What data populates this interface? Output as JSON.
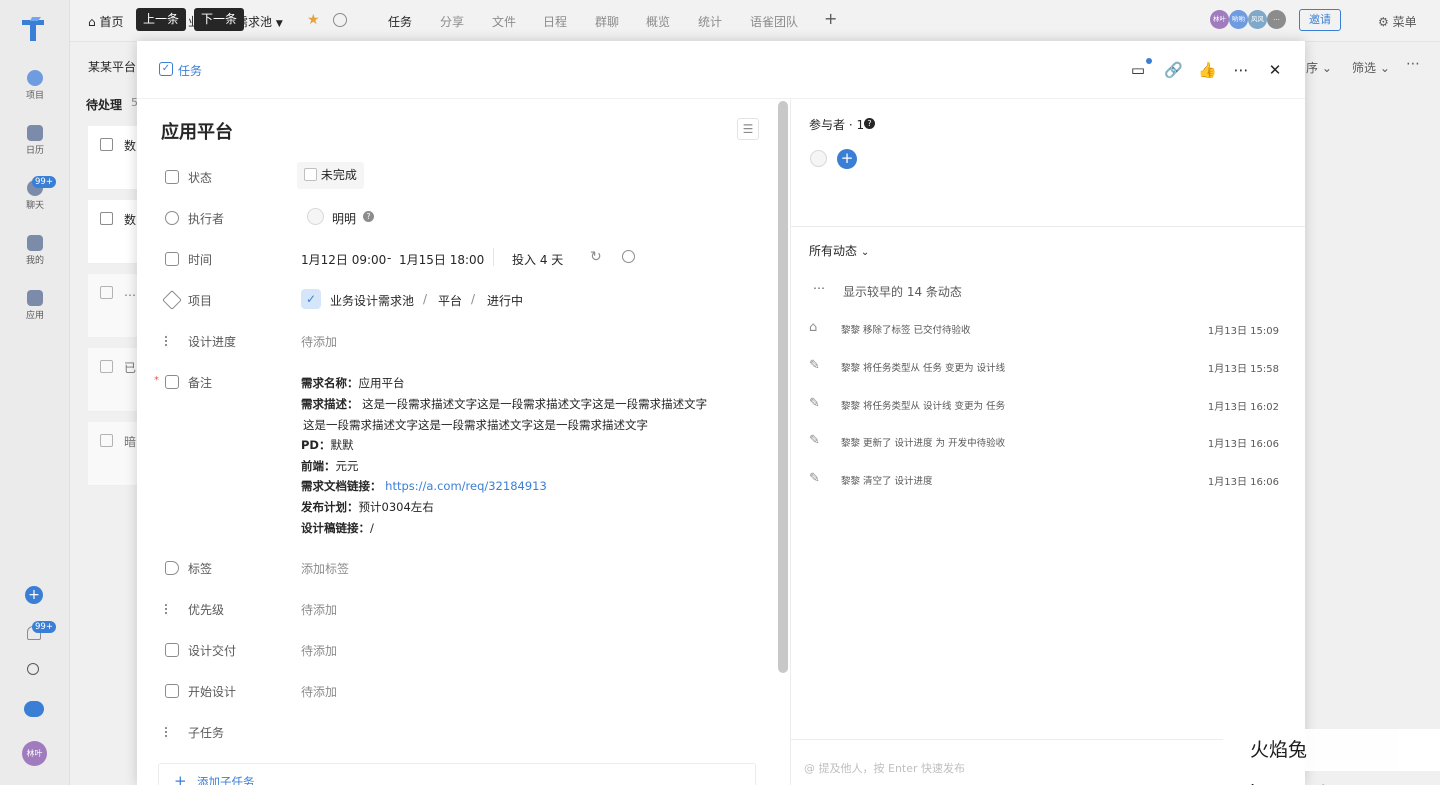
{
  "rail": {
    "items": [
      {
        "label": "项目",
        "icon": "project-icon"
      },
      {
        "label": "日历",
        "icon": "calendar-icon"
      },
      {
        "label": "聊天",
        "icon": "chat-icon",
        "badge": "99+"
      },
      {
        "label": "我的",
        "icon": "monitor-icon"
      },
      {
        "label": "应用",
        "icon": "apps-icon"
      }
    ],
    "bottom_badge": "99+",
    "avatar": "林叶"
  },
  "topbar": {
    "home": "首页",
    "prev_tip": "上一条",
    "next_tip": "下一条",
    "project_name": "业务设计需求池",
    "tabs": [
      "任务",
      "分享",
      "文件",
      "日程",
      "群聊",
      "概览",
      "统计",
      "语雀团队"
    ],
    "avatars": [
      "林叶",
      "哟哟",
      "风风",
      "..."
    ],
    "invite": "邀请",
    "menu": "菜单"
  },
  "background": {
    "crumb": "某某平台",
    "section": "待处理",
    "section_count": "5",
    "sort": "序",
    "filter": "筛选",
    "rows": [
      "数",
      "数",
      "…",
      "已",
      "暗"
    ]
  },
  "modal": {
    "type_label": "任务",
    "title": "应用平台",
    "fields": {
      "status_label": "状态",
      "status_value": "未完成",
      "assignee_label": "执行者",
      "assignee_value": "明明",
      "time_label": "时间",
      "time_start": "1月12日 09:00",
      "time_sep": "-",
      "time_end": "1月15日 18:00",
      "effort": "投入 4 天",
      "project_label": "项目",
      "project_value": "业务设计需求池",
      "project_sep1": "/",
      "project_stage": "平台",
      "project_sep2": "/",
      "project_status": "进行中",
      "design_progress_label": "设计进度",
      "design_progress_value": "待添加",
      "note_label": "备注",
      "tags_label": "标签",
      "tags_value": "添加标签",
      "priority_label": "优先级",
      "priority_value": "待添加",
      "delivery_label": "设计交付",
      "delivery_value": "待添加",
      "start_label": "开始设计",
      "start_value": "待添加",
      "subtask_label": "子任务",
      "add_subtask": "添加子任务"
    },
    "note": {
      "name_k": "需求名称：",
      "name_v": "应用平台",
      "desc_k": "需求描述：",
      "desc_v1": "这是一段需求描述文字这是一段需求描述文字这是一段需求描述文字",
      "desc_v2": "这是一段需求描述文字这是一段需求描述文字这是一段需求描述文字",
      "pd_k": "PD：",
      "pd_v": "默默",
      "fe_k": "前端：",
      "fe_v": "元元",
      "doc_k": "需求文档链接：",
      "doc_v": "https://a.com/req/32184913",
      "plan_k": "发布计划：",
      "plan_v": "预计0304左右",
      "design_k": "设计稿链接：",
      "design_v": "/"
    },
    "right": {
      "participants": "参与者 · 1",
      "activity_filter": "所有动态",
      "show_earlier": "显示较早的 14 条动态",
      "activities": [
        {
          "icon": "tag-icon",
          "text": "黎黎 移除了标签 已交付待验收",
          "time": "1月13日 15:09"
        },
        {
          "icon": "pencil-icon",
          "text": "黎黎 将任务类型从 任务 变更为 设计线",
          "time": "1月13日 15:58"
        },
        {
          "icon": "pencil-icon",
          "text": "黎黎 将任务类型从 设计线 变更为 任务",
          "time": "1月13日 16:02"
        },
        {
          "icon": "pencil-icon",
          "text": "黎黎 更新了 设计进度 为 开发中待验收",
          "time": "1月13日 16:06"
        },
        {
          "icon": "pencil-icon",
          "text": "黎黎 清空了 设计进度",
          "time": "1月13日 16:06"
        }
      ],
      "comment_placeholder": "@ 提及他人，按 Enter 快速发布"
    }
  },
  "watermark": "火焰兔 huoyantu.com",
  "colors": {
    "accent": "#3a7fd5",
    "tip_bg": "#262626",
    "star": "#e6a23c"
  }
}
